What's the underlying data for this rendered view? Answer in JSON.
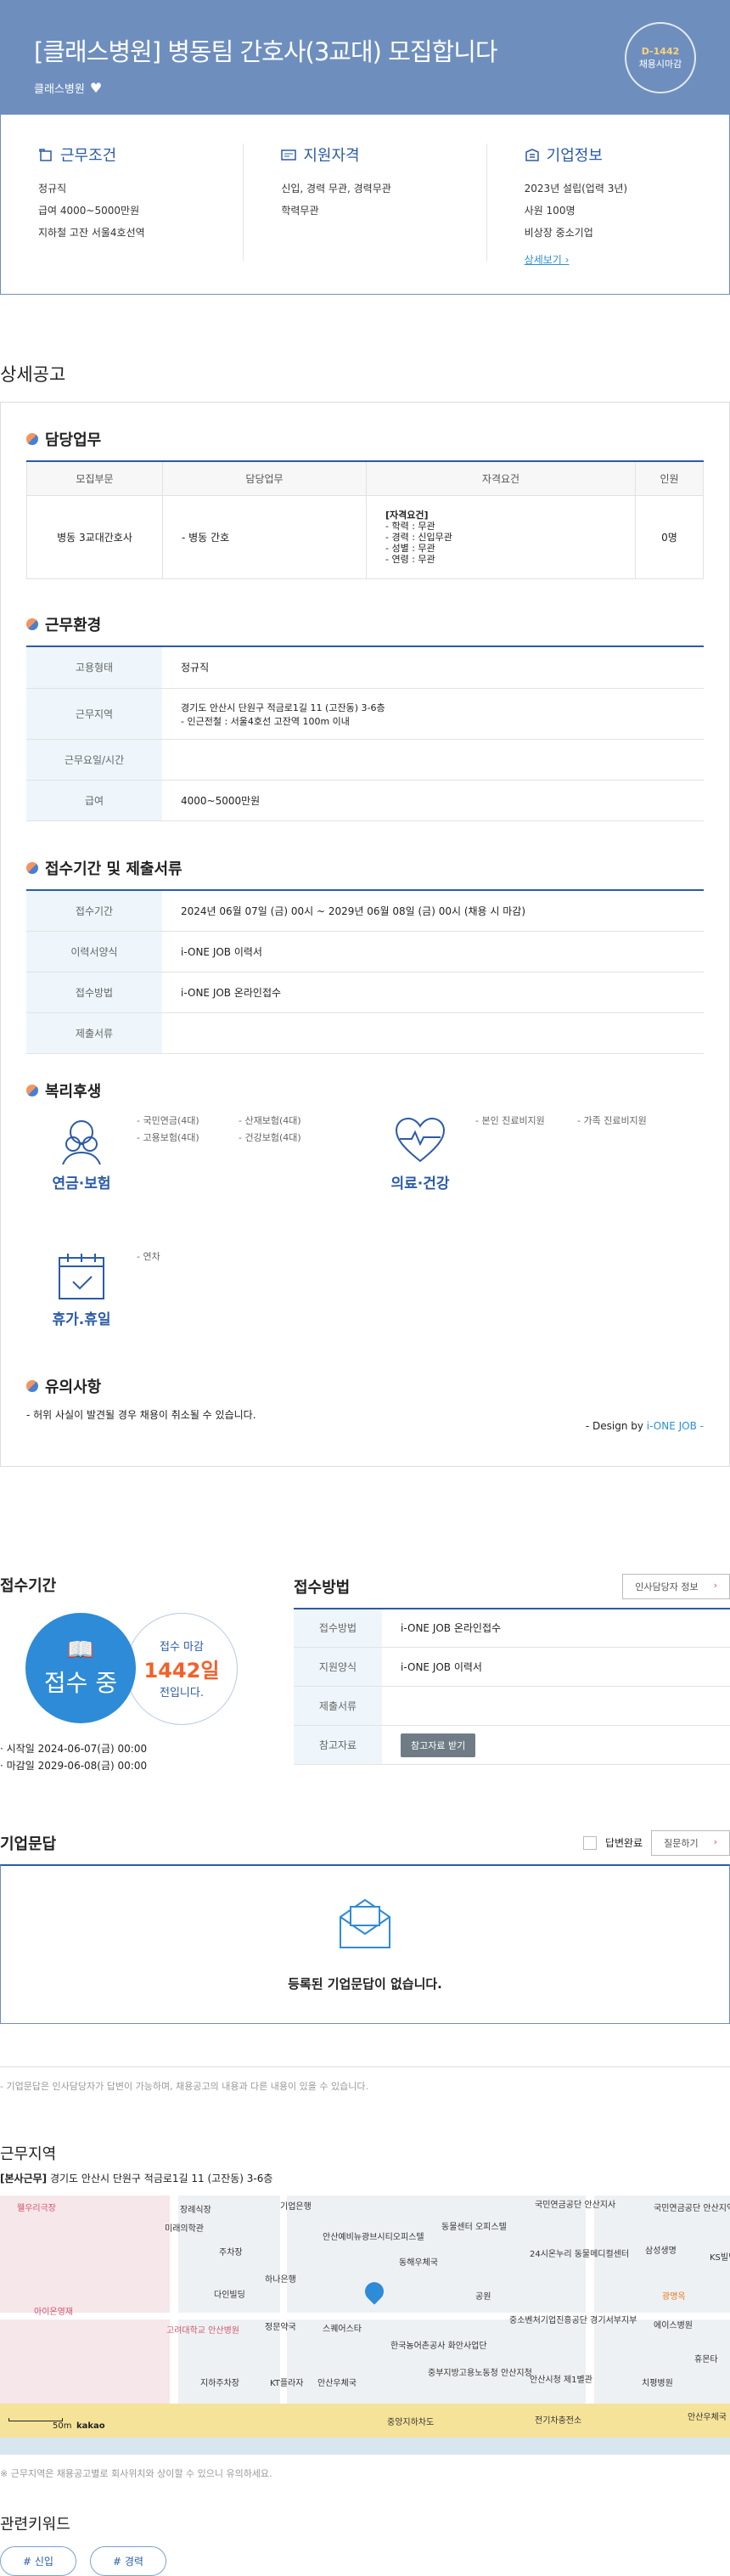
{
  "header": {
    "title": "[클래스병원] 병동팀 간호사(3교대) 모집합니다",
    "company": "클래스병원",
    "dday": "D-1442",
    "dday_sub": "채용시마감"
  },
  "summary": {
    "conditions": {
      "title": "근무조건",
      "lines": [
        "정규직",
        "급여 4000~5000만원",
        "지하철 고잔 서울4호선역"
      ]
    },
    "qualification": {
      "title": "지원자격",
      "lines": [
        "신입, 경력 무관, 경력무관",
        "학력무관"
      ]
    },
    "company": {
      "title": "기업정보",
      "lines": [
        "2023년 설립(업력 3년)",
        "사원 100명",
        "비상장 중소기업"
      ],
      "more": "상세보기"
    }
  },
  "detail_title": "상세공고",
  "duty": {
    "title": "담당업무",
    "headers": [
      "모집부문",
      "담당업무",
      "자격요건",
      "인원"
    ],
    "row": {
      "dept": "병동 3교대간호사",
      "task": "- 병동 간호",
      "req_title": "[자격요건]",
      "req_lines": [
        "- 학력 : 무관",
        "- 경력 : 신입무관",
        "- 성별 : 무관",
        "- 연령 : 무관"
      ],
      "count": "0명"
    }
  },
  "env": {
    "title": "근무환경",
    "rows": [
      {
        "label": "고용형태",
        "value": "정규직",
        "value2": ""
      },
      {
        "label": "근무지역",
        "value": "경기도 안산시 단원구 적금로1길 11 (고잔동) 3-6층",
        "value2": "- 인근전철 : 서울4호선 고잔역 100m 이내"
      },
      {
        "label": "근무요일/시간",
        "value": "",
        "value2": ""
      },
      {
        "label": "급여",
        "value": "4000~5000만원",
        "value2": ""
      }
    ]
  },
  "apply": {
    "title": "접수기간 및 제출서류",
    "rows": [
      {
        "label": "접수기간",
        "value": "2024년 06월 07일 (금) 00시 ~ 2029년 06월 08일 (금) 00시 (채용 시 마감)"
      },
      {
        "label": "이력서양식",
        "value": "i-ONE JOB 이력서"
      },
      {
        "label": "접수방법",
        "value": "i-ONE JOB 온라인접수"
      },
      {
        "label": "제출서류",
        "value": ""
      }
    ]
  },
  "welfare": {
    "title": "복리후생",
    "groups": [
      {
        "name": "연금·보험",
        "items": [
          "- 국민연금(4대)",
          "- 산재보험(4대)",
          "- 고용보험(4대)",
          "- 건강보험(4대)"
        ]
      },
      {
        "name": "의료·건강",
        "items": [
          "- 본인 진료비지원",
          "- 가족 진료비지원"
        ]
      },
      {
        "name": "휴가.휴일",
        "items": [
          "- 연차"
        ]
      }
    ]
  },
  "notice": {
    "title": "유의사항",
    "text": "- 허위 사실이 발견될 경우 채용이 취소될 수 있습니다.",
    "design_prefix": "- Design by ",
    "design_brand": "i-ONE JOB",
    "design_suffix": " -"
  },
  "period": {
    "title": "접수기간",
    "status": "접수 중",
    "deadline_pre": "접수 마감",
    "deadline_days": "1442일",
    "deadline_post": "전입니다.",
    "start": "· 시작일 2024-06-07(금) 00:00",
    "end": "· 마감일 2029-06-08(금) 00:00"
  },
  "method": {
    "title": "접수방법",
    "hr_button": "인사담당자 정보",
    "rows": [
      {
        "label": "접수방법",
        "value": "i-ONE JOB 온라인접수"
      },
      {
        "label": "지원양식",
        "value": "i-ONE JOB 이력서"
      },
      {
        "label": "제출서류",
        "value": ""
      },
      {
        "label": "참고자료",
        "value": ""
      }
    ],
    "ref_button": "참고자료 받기"
  },
  "qa": {
    "title": "기업문답",
    "answered": "답변완료",
    "ask": "질문하기",
    "empty": "등록된 기업문답이 없습니다.",
    "note": "- 기업문답은 인사담당자가 답변이 가능하며, 채용공고의 내용과 다른 내용이 있을 수 있습니다."
  },
  "location": {
    "title": "근무지역",
    "addr_label": "[본사근무]",
    "addr": "경기도 안산시 단원구 적금로1길 11 (고잔동) 3-6층",
    "map_labels": [
      "웰우리극장",
      "장례식장",
      "기업은행",
      "국민연금공단 안산지사",
      "국민연금공단 안산지역본부",
      "미래의학관",
      "주차장",
      "안산예비뉴광브시티오피스텔",
      "동해우체국",
      "동물센터 오피스텔",
      "삼성생명",
      "KS빌딩",
      "아이온영재",
      "고려대학교 안산병원",
      "하나은행",
      "24시온누리 동물메디컬센터",
      "광명옥",
      "다인빌딩",
      "공원",
      "중소벤처기업진흥공단 경기서부지부",
      "에이스병원",
      "정문약국",
      "스퀘어스타",
      "한국농어촌공사 화안사업단",
      "휴몬타",
      "지하주차장",
      "KT플라자",
      "안산우체국",
      "중부지방고용노동청 안산지청",
      "안산시청 제1별관",
      "치평병원",
      "중앙지하차도",
      "전기차충전소",
      "안산우체국"
    ],
    "scale": "50m",
    "kakao": "kakao",
    "note": "※ 근무지역은 채용공고별로 회사위치와 상이할 수 있으니 유의하세요."
  },
  "keywords": {
    "title": "관련키워드",
    "items": [
      "# 신입",
      "# 경력"
    ]
  },
  "colors": {
    "primary": "#2b5ba8",
    "hero": "#6e8fbe",
    "accent": "#f2612a"
  }
}
